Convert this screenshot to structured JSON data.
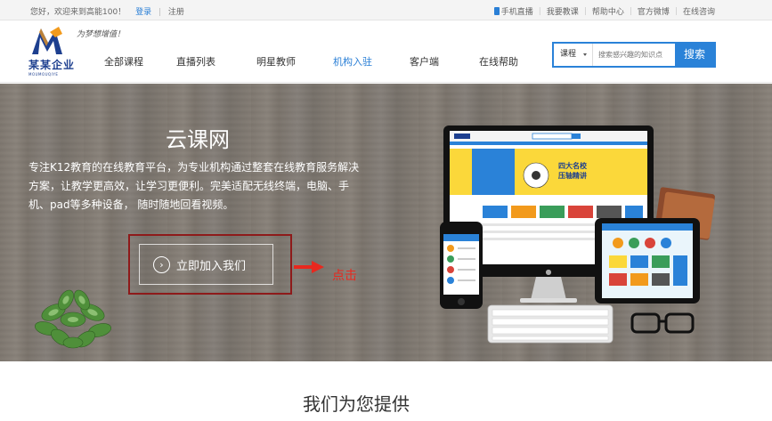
{
  "topbar": {
    "welcome": "您好，欢迎来到高能100！",
    "login": "登录",
    "divider": "|",
    "register": "注册",
    "links": [
      "手机直播",
      "我要教课",
      "帮助中心",
      "官方微博",
      "在线咨询"
    ]
  },
  "header": {
    "logo_name": "某某企业",
    "logo_sub": "MOUMOUQIYE",
    "slogan": "为梦想增值！",
    "nav": [
      "全部课程",
      "直播列表",
      "明星教师",
      "机构入驻",
      "客户端",
      "在线帮助"
    ],
    "nav_active_index": 3,
    "search": {
      "category": "课程",
      "placeholder": "搜索感兴趣的知识点",
      "button": "搜索"
    }
  },
  "banner": {
    "title": "云课网",
    "description": "专注K12教育的在线教育平台，为专业机构通过整套在线教育服务解决方案，让教学更高效，让学习更便利。完美适配无线终端，电脑、手机、pad等多种设备，  随时随地回看视频。",
    "join_button": "立即加入我们",
    "annotation": "点击",
    "screen_banner_line1": "四大名校",
    "screen_banner_line2": "压轴精讲"
  },
  "section": {
    "title": "我们为您提供"
  },
  "colors": {
    "accent": "#2a82d8",
    "annotation_red": "#e8281e",
    "outline_red": "#8e1a1a",
    "logo_blue": "#1d3f8f"
  }
}
